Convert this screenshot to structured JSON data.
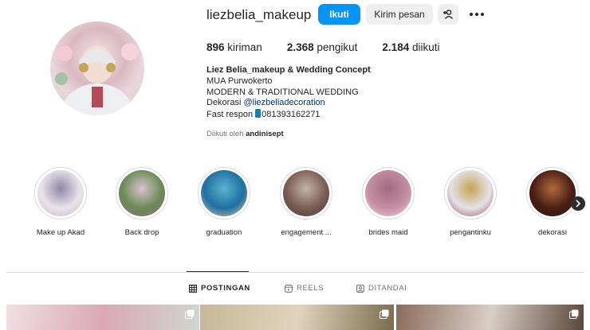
{
  "profile": {
    "username": "liezbelia_makeup",
    "follow_label": "Ikuti",
    "message_label": "Kirim pesan",
    "stats": {
      "posts_count": "896",
      "posts_label": "kiriman",
      "followers_count": "2.368",
      "followers_label": "pengikut",
      "following_count": "2.184",
      "following_label": "diikuti"
    },
    "bio": {
      "name": "Liez Belia_makeup & Wedding Concept",
      "line1": "MUA Purwokerto",
      "line2": "MODERN & TRADITIONAL WEDDING",
      "decor_prefix": "Dekorasi ",
      "decor_link": "@liezbeliadecoration",
      "fast_prefix": "Fast respon ",
      "phone": "081393162271"
    },
    "followed_by_prefix": "Diikuti oleh ",
    "followed_by_user": "andinisept"
  },
  "highlights": [
    {
      "label": "Make up Akad",
      "colors": [
        "#e9e4ea",
        "#8f86a8",
        "#c9b8c4"
      ]
    },
    {
      "label": "Back drop",
      "colors": [
        "#6b8a55",
        "#d8c3ce",
        "#8b6e86"
      ]
    },
    {
      "label": "graduation",
      "colors": [
        "#1f6fa0",
        "#5bb2d0",
        "#e1c9b7"
      ]
    },
    {
      "label": "engagement ...",
      "colors": [
        "#7a5d55",
        "#c6b3a8",
        "#4e3a35"
      ]
    },
    {
      "label": "brides maid",
      "colors": [
        "#c58ea2",
        "#a2697e",
        "#e8d7dc"
      ]
    },
    {
      "label": "pengantinku",
      "colors": [
        "#e5e2e7",
        "#c4a456",
        "#9c4f5f"
      ]
    },
    {
      "label": "dekorasi",
      "colors": [
        "#4a1e14",
        "#b06a3e",
        "#2d120d"
      ]
    }
  ],
  "tabs": [
    {
      "label": "POSTINGAN",
      "icon": "grid-icon",
      "active": true
    },
    {
      "label": "REELS",
      "icon": "reels-icon",
      "active": false
    },
    {
      "label": "DITANDAI",
      "icon": "tagged-icon",
      "active": false
    }
  ],
  "posts": [
    {
      "colors": [
        "#f1dfe3",
        "#d9a8b6",
        "#cfd7cf"
      ]
    },
    {
      "colors": [
        "#c7b798",
        "#e1d3bd",
        "#7a6a4d"
      ]
    },
    {
      "colors": [
        "#8b6b5a",
        "#d9cfc7",
        "#5a4438"
      ]
    }
  ]
}
